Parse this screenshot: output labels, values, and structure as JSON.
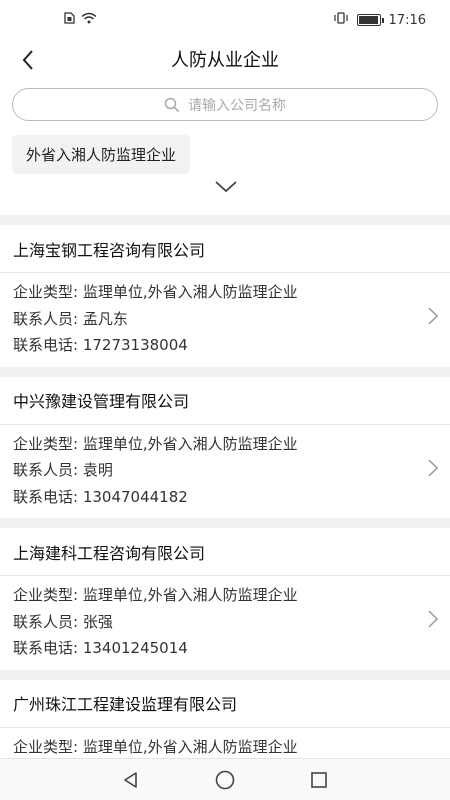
{
  "status_bar": {
    "time": "17:16",
    "icons": [
      "sim-icon",
      "wifi-icon",
      "vibrate-icon",
      "battery-icon"
    ],
    "battery_level": 0.9
  },
  "nav": {
    "title": "人防从业企业",
    "back_icon": "chevron-left-icon"
  },
  "search": {
    "placeholder": "请输入公司名称",
    "icon": "search-icon"
  },
  "filter": {
    "chip_label": "外省入湘人防监理企业",
    "expand_icon": "chevron-down-icon"
  },
  "companies": [
    {
      "name": "上海宝钢工程咨询有限公司",
      "type": "企业类型: 监理单位,外省入湘人防监理企业",
      "contact": "联系人员: 孟凡东",
      "phone": "联系电话: 17273138004"
    },
    {
      "name": "中兴豫建设管理有限公司",
      "type": "企业类型: 监理单位,外省入湘人防监理企业",
      "contact": "联系人员: 袁明",
      "phone": "联系电话: 13047044182"
    },
    {
      "name": "上海建科工程咨询有限公司",
      "type": "企业类型: 监理单位,外省入湘人防监理企业",
      "contact": "联系人员: 张强",
      "phone": "联系电话: 13401245014"
    },
    {
      "name": "广州珠江工程建设监理有限公司",
      "type": "企业类型: 监理单位,外省入湘人防监理企业",
      "contact": "",
      "phone": ""
    }
  ],
  "system_nav": {
    "back_icon": "triangle-back-icon",
    "home_icon": "circle-home-icon",
    "recents_icon": "square-recents-icon"
  }
}
